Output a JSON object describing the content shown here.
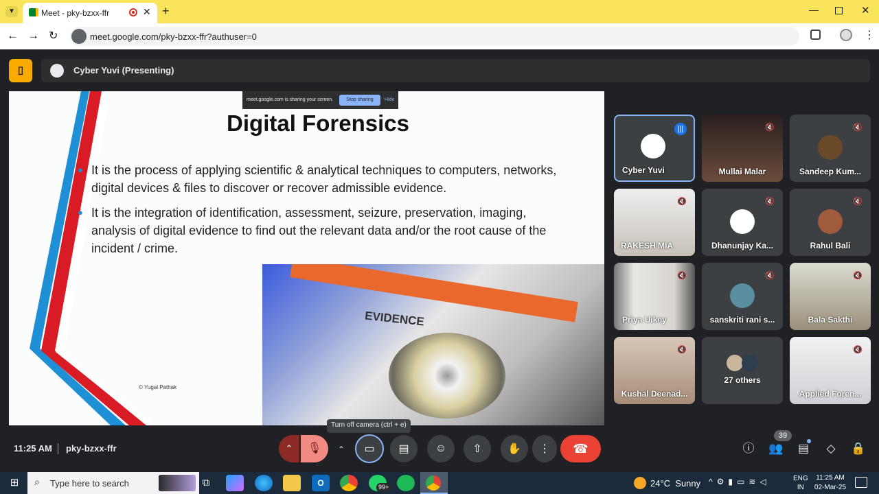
{
  "browser": {
    "tab_title": "Meet - pky-bzxx-ffr",
    "url": "meet.google.com/pky-bzxx-ffr?authuser=0"
  },
  "meet": {
    "presenter_label": "Cyber Yuvi (Presenting)",
    "share_banner": {
      "text": "meet.google.com is sharing your screen.",
      "stop": "Stop sharing",
      "hide": "Hide"
    },
    "time": "11:25 AM",
    "meeting_code": "pky-bzxx-ffr",
    "tooltip": "Turn off camera (ctrl + e)",
    "people_count": "39",
    "participants": [
      {
        "name": "Cyber Yuvi",
        "speaking": true
      },
      {
        "name": "Mullai Malar"
      },
      {
        "name": "Sandeep Kum..."
      },
      {
        "name": "RAKESH MIA"
      },
      {
        "name": "Dhanunjay Ka..."
      },
      {
        "name": "Rahul Bali"
      },
      {
        "name": "Priya Uikey"
      },
      {
        "name": "sanskriti rani s..."
      },
      {
        "name": "Bala Sakthi"
      },
      {
        "name": "Kushal Deenad..."
      },
      {
        "name": "27 others"
      },
      {
        "name": "Applied Foren..."
      }
    ]
  },
  "slide": {
    "title": "Digital Forensics",
    "bullets": [
      "It is the process of applying scientific & analytical techniques to computers, networks, digital devices & files to discover or recover admissible evidence.",
      "It is the integration of identification, assessment, seizure, preservation, imaging, analysis of digital evidence to find out the relevant data and/or the root cause of the incident / crime."
    ],
    "credit": "© Yugal Pathak",
    "photo_text": "EVIDENCE"
  },
  "taskbar": {
    "search_placeholder": "Type here to search",
    "whatsapp_badge": "99+",
    "weather": "24°C  Sunny",
    "lang_top": "ENG",
    "lang_bottom": "IN",
    "clock_time": "11:25 AM",
    "clock_date": "02-Mar-25"
  },
  "colors": {
    "end_call": "#ea4335",
    "speaking_border": "#8ab4f8",
    "accent_red": "#d81b24",
    "accent_blue": "#1f8fd6"
  }
}
